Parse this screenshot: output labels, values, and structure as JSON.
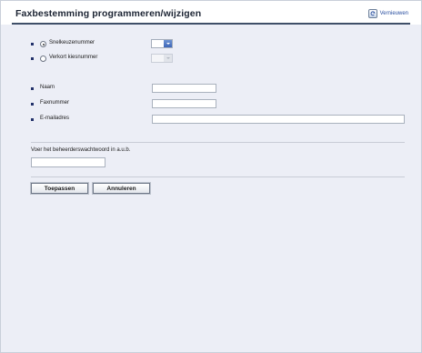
{
  "header": {
    "title": "Faxbestemming programmeren/wijzigen",
    "refresh_label": "Vernieuwen",
    "refresh_icon": "refresh-icon"
  },
  "form": {
    "speed_dial": {
      "label": "Snelkeuzenummer",
      "selected": true,
      "value": ""
    },
    "short_dial": {
      "label": "Verkort kiesnummer",
      "selected": false,
      "value": ""
    },
    "name": {
      "label": "Naam",
      "value": ""
    },
    "fax_number": {
      "label": "Faxnummer",
      "value": ""
    },
    "email": {
      "label": "E-mailadres",
      "value": ""
    },
    "password": {
      "label": "Voer het beheerderswachtwoord in a.u.b.",
      "value": ""
    }
  },
  "buttons": {
    "apply": "Toepassen",
    "cancel": "Annuleren"
  },
  "colors": {
    "accent": "#3e66b8",
    "content_bg": "#eceef6",
    "title_rule": "#3f4f68",
    "bullet": "#23326b"
  }
}
